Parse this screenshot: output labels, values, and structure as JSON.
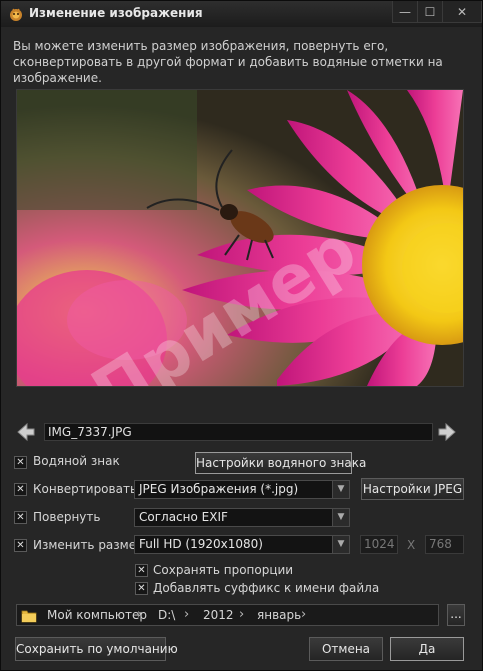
{
  "window": {
    "title": "Изменение изображения",
    "controls": {
      "minimize": "—",
      "maximize": "☐",
      "close": "✕"
    }
  },
  "description": "Вы можете изменить размер изображения, повернуть его, сконвертировать в другой формат и добавить водяные отметки на изображение.",
  "preview": {
    "watermark_text": "Пример"
  },
  "file": {
    "name": "IMG_7337.JPG"
  },
  "options": {
    "watermark": {
      "label": "Водяной знак",
      "checked": true,
      "button": "Настройки водяного знака"
    },
    "convert": {
      "label": "Конвертировать",
      "checked": true,
      "format": "JPEG Изображения  (*.jpg)",
      "button": "Настройки JPEG"
    },
    "rotate": {
      "label": "Повернуть",
      "checked": true,
      "value": "Согласно EXIF"
    },
    "resize": {
      "label": "Изменить размер",
      "checked": true,
      "preset": "Full HD (1920x1080)",
      "width": "1024",
      "height": "768",
      "separator": "X"
    },
    "keep_ratio": {
      "label": "Сохранять пропорции",
      "checked": true
    },
    "add_suffix": {
      "label": "Добавлять суффикс к имени файла",
      "checked": true
    }
  },
  "path": {
    "segments": [
      "Мой компьютер",
      "D:\\",
      "2012",
      "январь"
    ],
    "browse_label": "..."
  },
  "footer": {
    "save_default": "Сохранить по умолчанию",
    "cancel": "Отмена",
    "ok": "Да"
  },
  "colors": {
    "petal": "#e8318f",
    "center": "#f7d21a",
    "background": "#262626"
  }
}
